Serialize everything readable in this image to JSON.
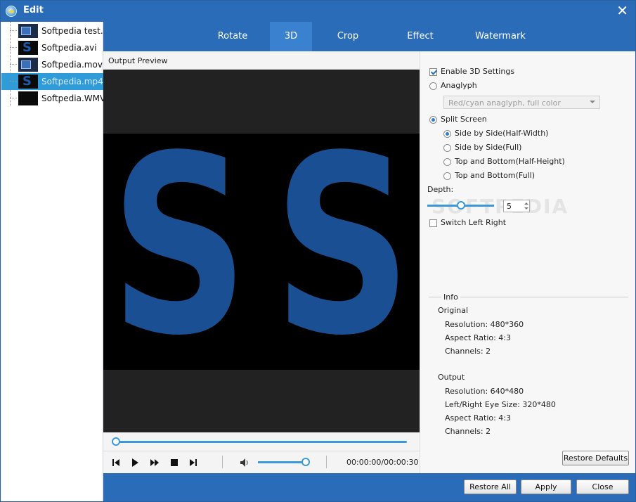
{
  "window": {
    "title": "Edit",
    "close_glyph": "✕"
  },
  "files": [
    {
      "name": "Softpedia test....",
      "thumb": "video-thumb",
      "selected": false
    },
    {
      "name": "Softpedia.avi",
      "thumb": "s-thumb",
      "selected": false
    },
    {
      "name": "Softpedia.mov",
      "thumb": "video-thumb",
      "selected": false
    },
    {
      "name": "Softpedia.mp4",
      "thumb": "s-thumb",
      "selected": true
    },
    {
      "name": "Softpedia.WMV",
      "thumb": "black-thumb",
      "selected": false
    }
  ],
  "tabs": [
    "Rotate",
    "3D",
    "Crop",
    "Effect",
    "Watermark"
  ],
  "active_tab": "3D",
  "preview": {
    "label": "Output Preview",
    "frame_glyphs": [
      "S",
      "S"
    ],
    "time": "00:00:00/00:00:30",
    "seek_position": 0.0,
    "volume": 0.95
  },
  "settings": {
    "enable_3d": {
      "label": "Enable 3D Settings",
      "checked": true
    },
    "anaglyph": {
      "label": "Anaglyph",
      "selected": false,
      "option": "Red/cyan anaglyph, full color"
    },
    "split_screen": {
      "label": "Split Screen",
      "selected": true
    },
    "split_options": [
      {
        "label": "Side by Side(Half-Width)",
        "selected": true
      },
      {
        "label": "Side by Side(Full)",
        "selected": false
      },
      {
        "label": "Top and Bottom(Half-Height)",
        "selected": false
      },
      {
        "label": "Top and Bottom(Full)",
        "selected": false
      }
    ],
    "depth": {
      "label": "Depth:",
      "value": "5",
      "level": 0.45
    },
    "switch_lr": {
      "label": "Switch Left Right",
      "checked": false
    },
    "watermark_text": "SOFTPEDIA"
  },
  "info": {
    "title": "Info",
    "original": {
      "heading": "Original",
      "resolution": "Resolution: 480*360",
      "aspect": "Aspect Ratio: 4:3",
      "channels": "Channels: 2"
    },
    "output": {
      "heading": "Output",
      "resolution": "Resolution: 640*480",
      "eye_size": "Left/Right Eye Size: 320*480",
      "aspect": "Aspect Ratio: 4:3",
      "channels": "Channels: 2"
    }
  },
  "buttons": {
    "restore_defaults": "Restore Defaults",
    "restore_all": "Restore All",
    "apply": "Apply",
    "close": "Close"
  },
  "colors": {
    "accent": "#2b6cb8",
    "selected_file": "#2f9bd9",
    "frame_letter": "#1a4f93"
  }
}
